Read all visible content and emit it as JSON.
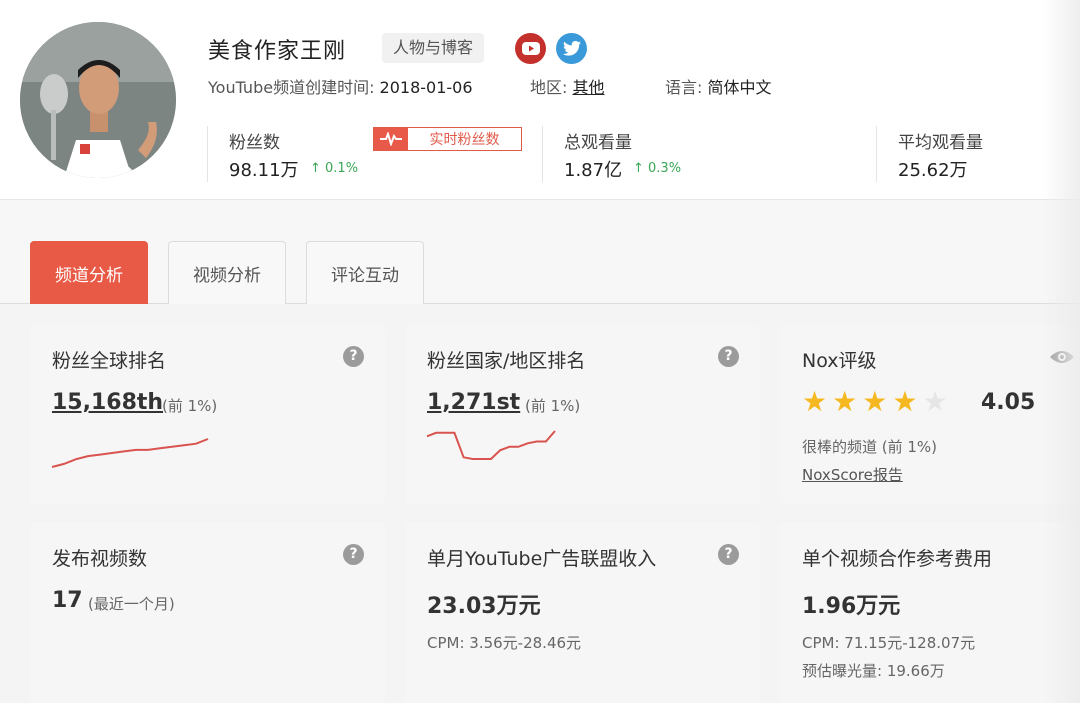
{
  "channel": {
    "name": "美食作家王刚",
    "category": "人物与博客",
    "created_label": "YouTube频道创建时间: ",
    "created_date": "2018-01-06",
    "region_label": "地区: ",
    "region_value": "其他",
    "language_label": "语言: ",
    "language_value": "简体中文"
  },
  "stats": {
    "fans_label": "粉丝数",
    "fans_value": "98.11万",
    "fans_delta": "0.1%",
    "realtime_label": "实时粉丝数",
    "views_label": "总观看量",
    "views_value": "1.87亿",
    "views_delta": "0.3%",
    "avg_label": "平均观看量",
    "avg_value": "25.62万"
  },
  "tabs": [
    {
      "label": "频道分析",
      "active": true
    },
    {
      "label": "视频分析",
      "active": false
    },
    {
      "label": "评论互动",
      "active": false
    }
  ],
  "cards": {
    "global_rank": {
      "title": "粉丝全球排名",
      "value": "15,168th",
      "note": "(前 1%)",
      "trend": [
        6,
        8,
        11,
        13,
        14,
        15,
        16,
        17,
        17,
        18,
        19,
        20,
        21,
        24
      ]
    },
    "country_rank": {
      "title": "粉丝国家/地区排名",
      "value": "1,271st",
      "note": "(前 1%)",
      "trend": [
        18,
        20,
        20,
        20,
        6,
        5,
        5,
        5,
        10,
        12,
        12,
        14,
        15,
        15,
        21
      ]
    },
    "nox": {
      "title": "Nox评级",
      "score": "4.05",
      "stars_filled": 4,
      "stars_total": 5,
      "desc": "很棒的频道 (前 1%)",
      "report_link": "NoxScore报告"
    },
    "videos": {
      "title": "发布视频数",
      "value": "17",
      "note": "(最近一个月)"
    },
    "ad_income": {
      "title": "单月YouTube广告联盟收入",
      "value": "23.03万元",
      "cpm": "CPM: 3.56元-28.46元"
    },
    "coop_fee": {
      "title": "单个视频合作参考费用",
      "value": "1.96万元",
      "cpm": "CPM: 71.15元-128.07元",
      "exposure": "预估曝光量: 19.66万"
    }
  },
  "help_symbol": "?",
  "colors": {
    "accent": "#e85a46",
    "up": "#3aa655",
    "star": "#f5b820",
    "star_empty": "#e6e6e6"
  },
  "icons": {
    "youtube": "youtube-icon",
    "twitter": "twitter-icon",
    "eye": "eye-icon",
    "help": "help-icon",
    "pulse": "pulse-icon"
  }
}
